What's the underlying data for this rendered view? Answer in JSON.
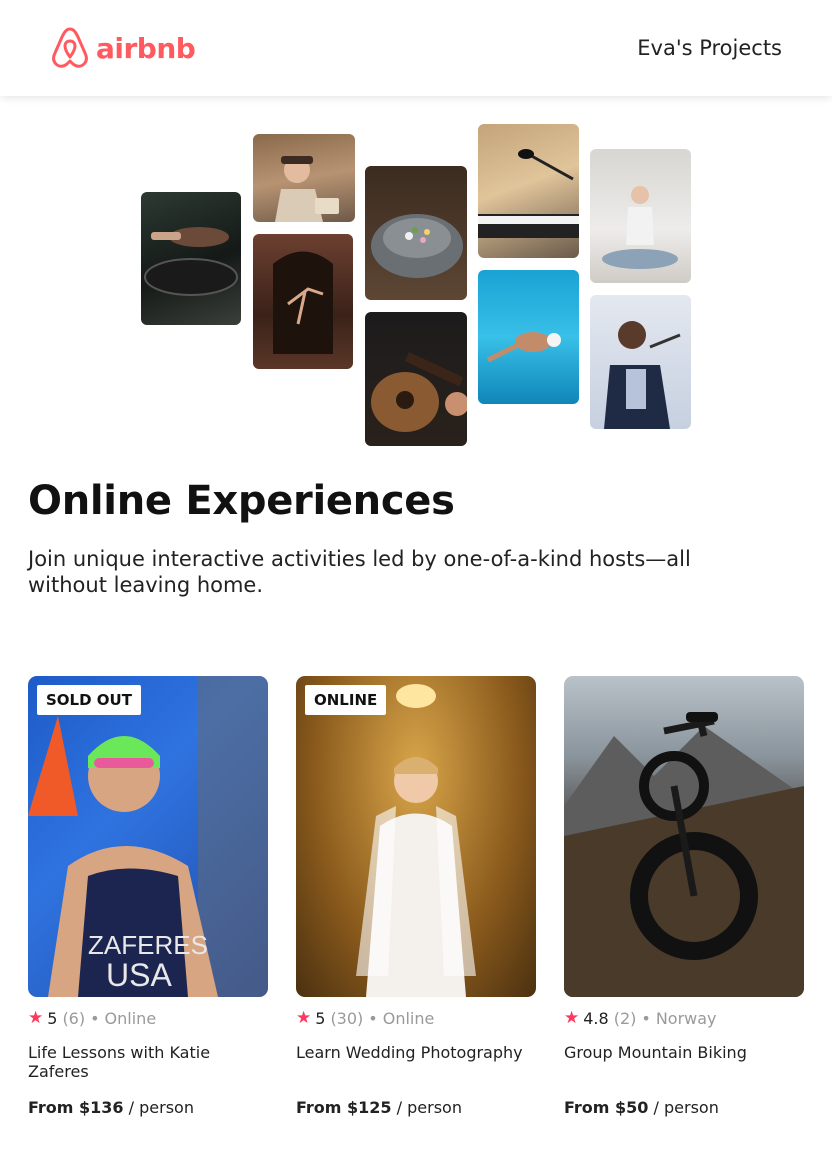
{
  "header": {
    "logo_text": "airbnb",
    "nav_link": "Eva's Projects"
  },
  "colors": {
    "brand": "#FF5A5F",
    "star": "#FF385C",
    "muted": "#9a9a9a"
  },
  "hero": {
    "tiles": [
      {
        "icon": "cooking-photo"
      },
      {
        "icon": "baker-woman-photo"
      },
      {
        "icon": "ballet-dancer-photo"
      },
      {
        "icon": "food-bowl-photo"
      },
      {
        "icon": "guitar-photo"
      },
      {
        "icon": "piano-microphone-photo"
      },
      {
        "icon": "swimmer-photo"
      },
      {
        "icon": "yoga-photo"
      },
      {
        "icon": "singer-photo"
      }
    ]
  },
  "main": {
    "title": "Online Experiences",
    "subtitle": "Join unique interactive activities led by one-of-a-kind hosts—all without leaving home."
  },
  "cards": [
    {
      "badge": "SOLD OUT",
      "rating": "5",
      "reviews": "(6)",
      "separator": "•",
      "location": "Online",
      "title": "Life Lessons with Katie Zaferes",
      "price": "From $136",
      "per": "/ person",
      "image": "triathlete-photo"
    },
    {
      "badge": "ONLINE",
      "rating": "5",
      "reviews": "(30)",
      "separator": "•",
      "location": "Online",
      "title": "Learn Wedding Photography",
      "price": "From $125",
      "per": "/ person",
      "image": "bride-photo"
    },
    {
      "badge": "",
      "rating": "4.8",
      "reviews": "(2)",
      "separator": "•",
      "location": "Norway",
      "title": "Group Mountain Biking",
      "price": "From $50",
      "per": "/ person",
      "image": "mountain-bike-photo"
    }
  ]
}
